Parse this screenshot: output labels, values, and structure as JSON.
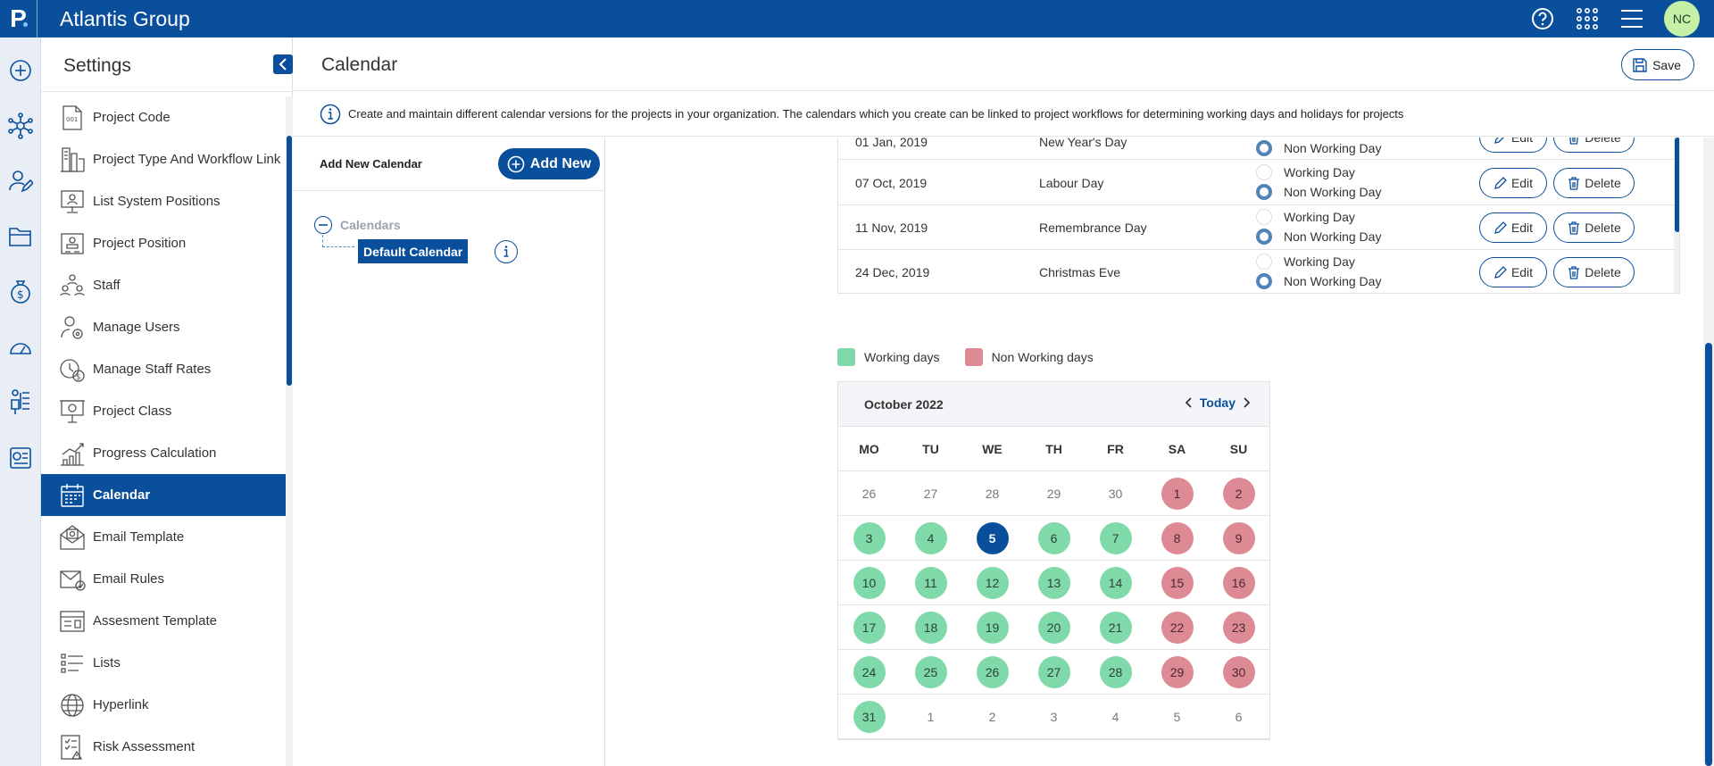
{
  "app": {
    "logo": "P",
    "company": "Atlantis Group",
    "user_initials": "NC"
  },
  "topbar": {
    "icons": [
      "help-icon",
      "apps-grid-icon",
      "menu-icon"
    ]
  },
  "rail": {
    "icons": [
      "add-icon",
      "network-icon",
      "user-edit-icon",
      "folder-icon",
      "money-icon",
      "dashboard-icon",
      "org-chart-icon",
      "report-icon"
    ]
  },
  "settings": {
    "title": "Settings",
    "items": [
      {
        "label": "Project Code",
        "icon": "code-doc-icon"
      },
      {
        "label": "Project Type And Workflow Link",
        "icon": "workflow-icon"
      },
      {
        "label": "List System Positions",
        "icon": "positions-icon"
      },
      {
        "label": "Project Position",
        "icon": "project-position-icon"
      },
      {
        "label": "Staff",
        "icon": "staff-icon"
      },
      {
        "label": "Manage Users",
        "icon": "manage-users-icon"
      },
      {
        "label": "Manage Staff Rates",
        "icon": "staff-rates-icon"
      },
      {
        "label": "Project Class",
        "icon": "project-class-icon"
      },
      {
        "label": "Progress Calculation",
        "icon": "progress-chart-icon"
      },
      {
        "label": "Calendar",
        "icon": "calendar-icon",
        "active": true
      },
      {
        "label": "Email Template",
        "icon": "email-template-icon"
      },
      {
        "label": "Email Rules",
        "icon": "email-rules-icon"
      },
      {
        "label": "Assesment Template",
        "icon": "assessment-template-icon"
      },
      {
        "label": "Lists",
        "icon": "list-icon"
      },
      {
        "label": "Hyperlink",
        "icon": "globe-icon"
      },
      {
        "label": "Risk Assessment",
        "icon": "risk-icon"
      }
    ]
  },
  "main": {
    "title": "Calendar",
    "save_label": "Save",
    "info_text": "Create and maintain different calendar versions for the projects in your organization. The calendars which you create can be linked to project workflows for determining working days and holidays for projects"
  },
  "tree": {
    "add_new_label": "Add New Calendar",
    "add_new_button": "Add New",
    "root_label": "Calendars",
    "node_label": "Default Calendar"
  },
  "holidays": {
    "working_label": "Working Day",
    "non_working_label": "Non Working Day",
    "edit_label": "Edit",
    "delete_label": "Delete",
    "rows": [
      {
        "date": "01 Jan, 2019",
        "name": "New Year's Day",
        "type": "non_working"
      },
      {
        "date": "07 Oct, 2019",
        "name": "Labour Day",
        "type": "non_working"
      },
      {
        "date": "11 Nov, 2019",
        "name": "Remembrance Day",
        "type": "non_working"
      },
      {
        "date": "24 Dec, 2019",
        "name": "Christmas Eve",
        "type": "non_working"
      }
    ]
  },
  "legend": {
    "working": {
      "label": "Working days",
      "color": "#7fd9a8"
    },
    "non_working": {
      "label": "Non Working days",
      "color": "#de8a94"
    }
  },
  "month": {
    "title": "October 2022",
    "today_label": "Today",
    "weekdays": [
      "MO",
      "TU",
      "WE",
      "TH",
      "FR",
      "SA",
      "SU"
    ],
    "weeks": [
      [
        {
          "d": "26",
          "t": "other"
        },
        {
          "d": "27",
          "t": "other"
        },
        {
          "d": "28",
          "t": "other"
        },
        {
          "d": "29",
          "t": "other"
        },
        {
          "d": "30",
          "t": "other"
        },
        {
          "d": "1",
          "t": "nonworking"
        },
        {
          "d": "2",
          "t": "nonworking"
        }
      ],
      [
        {
          "d": "3",
          "t": "working"
        },
        {
          "d": "4",
          "t": "working"
        },
        {
          "d": "5",
          "t": "today"
        },
        {
          "d": "6",
          "t": "working"
        },
        {
          "d": "7",
          "t": "working"
        },
        {
          "d": "8",
          "t": "nonworking"
        },
        {
          "d": "9",
          "t": "nonworking"
        }
      ],
      [
        {
          "d": "10",
          "t": "working"
        },
        {
          "d": "11",
          "t": "working"
        },
        {
          "d": "12",
          "t": "working"
        },
        {
          "d": "13",
          "t": "working"
        },
        {
          "d": "14",
          "t": "working"
        },
        {
          "d": "15",
          "t": "nonworking"
        },
        {
          "d": "16",
          "t": "nonworking"
        }
      ],
      [
        {
          "d": "17",
          "t": "working"
        },
        {
          "d": "18",
          "t": "working"
        },
        {
          "d": "19",
          "t": "working"
        },
        {
          "d": "20",
          "t": "working"
        },
        {
          "d": "21",
          "t": "working"
        },
        {
          "d": "22",
          "t": "nonworking"
        },
        {
          "d": "23",
          "t": "nonworking"
        }
      ],
      [
        {
          "d": "24",
          "t": "working"
        },
        {
          "d": "25",
          "t": "working"
        },
        {
          "d": "26",
          "t": "working"
        },
        {
          "d": "27",
          "t": "working"
        },
        {
          "d": "28",
          "t": "working"
        },
        {
          "d": "29",
          "t": "nonworking"
        },
        {
          "d": "30",
          "t": "nonworking"
        }
      ],
      [
        {
          "d": "31",
          "t": "working"
        },
        {
          "d": "1",
          "t": "other"
        },
        {
          "d": "2",
          "t": "other"
        },
        {
          "d": "3",
          "t": "other"
        },
        {
          "d": "4",
          "t": "other"
        },
        {
          "d": "5",
          "t": "other"
        },
        {
          "d": "6",
          "t": "other"
        }
      ]
    ]
  },
  "colors": {
    "brand": "#0a4f9c",
    "avatar_bg": "#c6f0a6"
  }
}
